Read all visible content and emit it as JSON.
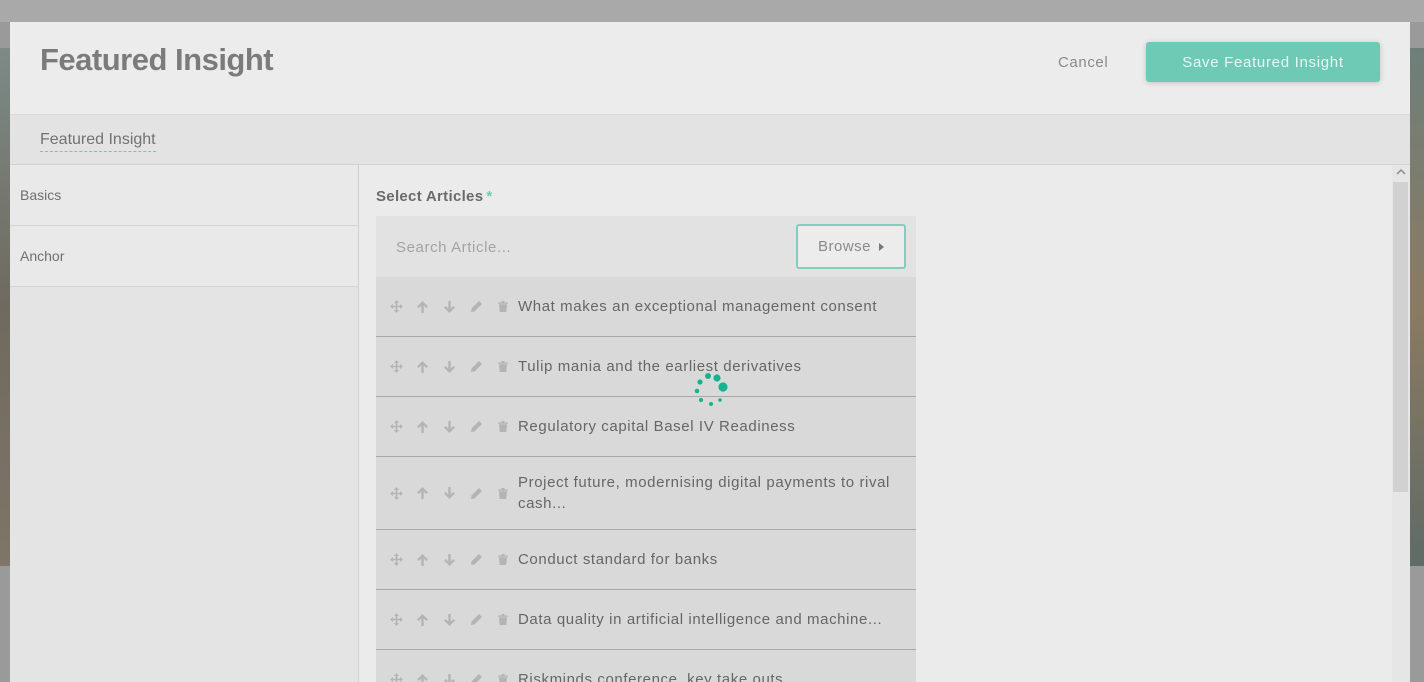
{
  "modal": {
    "title": "Featured Insight",
    "cancel_label": "Cancel",
    "save_label": "Save Featured Insight"
  },
  "tabs": [
    {
      "label": "Featured Insight",
      "active": true
    }
  ],
  "sidebar": {
    "items": [
      {
        "label": "Basics"
      },
      {
        "label": "Anchor"
      }
    ]
  },
  "articles_field": {
    "label": "Select Articles",
    "required_mark": "*",
    "search_placeholder": "Search Article...",
    "browse_label": "Browse",
    "items": [
      {
        "title": "What makes an exceptional management consent"
      },
      {
        "title": "Tulip mania and the earliest derivatives"
      },
      {
        "title": "Regulatory capital Basel IV Readiness"
      },
      {
        "title": "Project future, modernising digital payments to rival cash..."
      },
      {
        "title": "Conduct standard for banks"
      },
      {
        "title": "Data quality in artificial intelligence and machine..."
      },
      {
        "title": "Riskminds conference, key take outs"
      }
    ],
    "item_controls": [
      "move-icon",
      "arrow-up-icon",
      "arrow-down-icon",
      "pencil-icon",
      "trash-icon"
    ]
  },
  "loading_spinner": {
    "visible": true
  },
  "colors": {
    "accent": "#6fcab5",
    "modal_background": "#ebebeb",
    "row_background": "#d9d9d9"
  }
}
